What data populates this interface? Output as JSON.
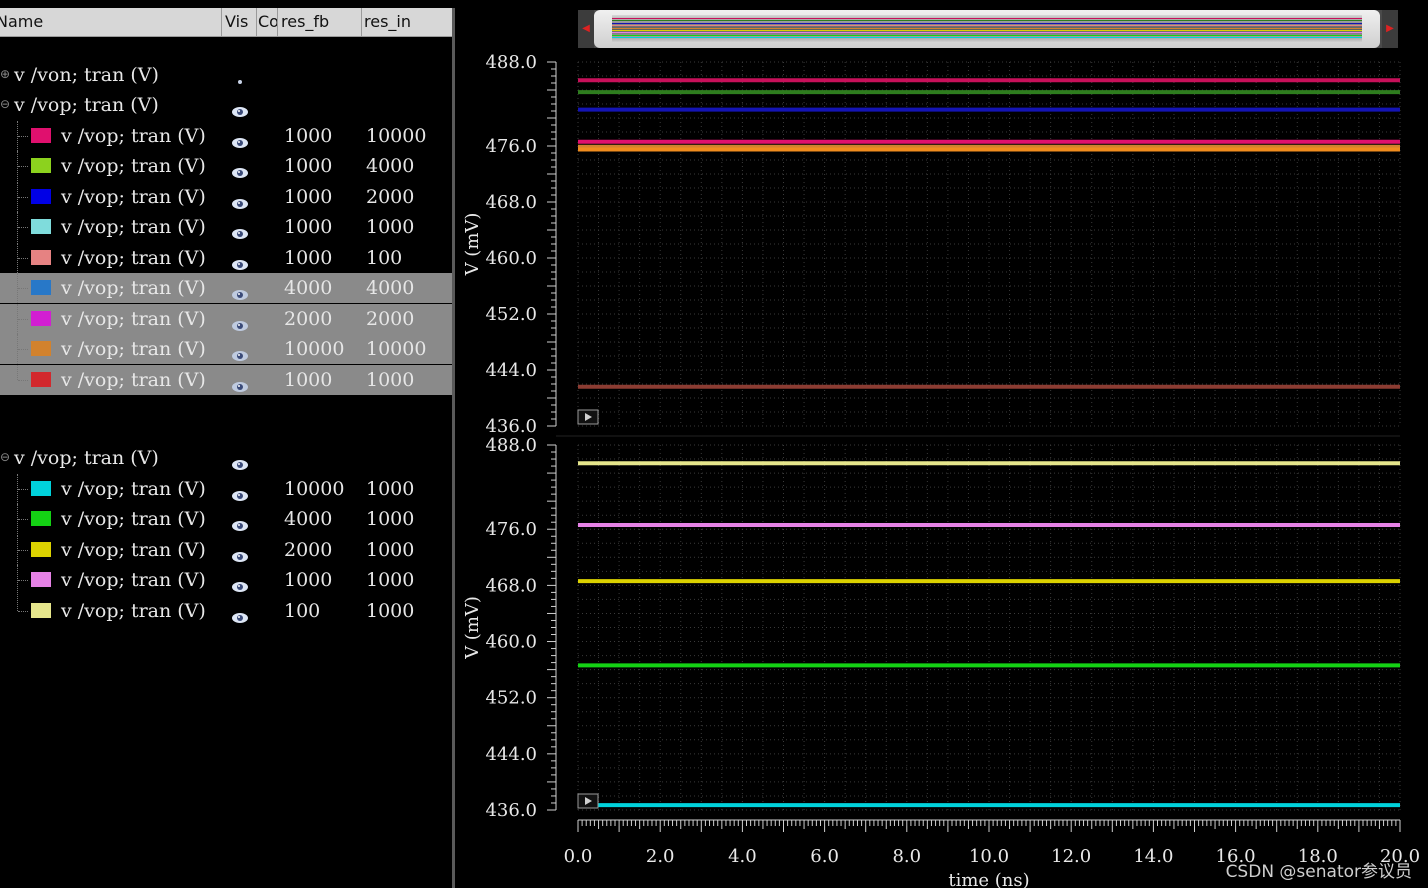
{
  "table": {
    "headers": {
      "name": "Name",
      "vis": "Vis",
      "co": "Co",
      "res_fb": "res_fb",
      "res_in": "res_in"
    }
  },
  "groups": [
    {
      "label": "v /von; tran (V)",
      "expander": "⊕",
      "visible": "dot"
    },
    {
      "label": "v /vop; tran (V)",
      "expander": "⊖",
      "visible": "eye",
      "signals": [
        {
          "label": "v /vop; tran (V)",
          "color": "#e0106e",
          "res_fb": "1000",
          "res_in": "10000",
          "selected": false
        },
        {
          "label": "v /vop; tran (V)",
          "color": "#8cd21e",
          "res_fb": "1000",
          "res_in": "4000",
          "selected": false
        },
        {
          "label": "v /vop; tran (V)",
          "color": "#0000e6",
          "res_fb": "1000",
          "res_in": "2000",
          "selected": false
        },
        {
          "label": "v /vop; tran (V)",
          "color": "#7fdcdc",
          "res_fb": "1000",
          "res_in": "1000",
          "selected": false
        },
        {
          "label": "v /vop; tran (V)",
          "color": "#e68282",
          "res_fb": "1000",
          "res_in": "100",
          "selected": false
        },
        {
          "label": "v /vop; tran (V)",
          "color": "#2878c8",
          "res_fb": "4000",
          "res_in": "4000",
          "selected": true
        },
        {
          "label": "v /vop; tran (V)",
          "color": "#d21ed2",
          "res_fb": "2000",
          "res_in": "2000",
          "selected": true
        },
        {
          "label": "v /vop; tran (V)",
          "color": "#d2822d",
          "res_fb": "10000",
          "res_in": "10000",
          "selected": true
        },
        {
          "label": "v /vop; tran (V)",
          "color": "#d2282d",
          "res_fb": "1000",
          "res_in": "1000",
          "selected": true
        }
      ]
    },
    {
      "label": "v /vop; tran (V)",
      "expander": "⊖",
      "visible": "eye",
      "signals": [
        {
          "label": "v /vop; tran (V)",
          "color": "#00d2dc",
          "res_fb": "10000",
          "res_in": "1000",
          "selected": false
        },
        {
          "label": "v /vop; tran (V)",
          "color": "#14d214",
          "res_fb": "4000",
          "res_in": "1000",
          "selected": false
        },
        {
          "label": "v /vop; tran (V)",
          "color": "#dcd200",
          "res_fb": "2000",
          "res_in": "1000",
          "selected": false
        },
        {
          "label": "v /vop; tran (V)",
          "color": "#e682e6",
          "res_fb": "1000",
          "res_in": "1000",
          "selected": false
        },
        {
          "label": "v /vop; tran (V)",
          "color": "#e6e68c",
          "res_fb": "100",
          "res_in": "1000",
          "selected": false
        }
      ]
    }
  ],
  "chart_data": [
    {
      "type": "line",
      "ylabel": "V (mV)",
      "xlabel": "",
      "ylim": [
        436.0,
        488.0
      ],
      "yticks": [
        "488.0",
        "476.0",
        "468.0",
        "460.0",
        "452.0",
        "444.0",
        "436.0"
      ],
      "xlim": [
        0,
        20
      ],
      "series": [
        {
          "color": "#c8105a",
          "y": 485.4
        },
        {
          "color": "#2e7d1e",
          "y": 483.7
        },
        {
          "color": "#1414b4",
          "y": 481.2
        },
        {
          "color": "#e0106e",
          "y": 476.6
        },
        {
          "color": "#d2822d",
          "y": 475.9
        },
        {
          "color": "#f08c1e",
          "y": 475.5
        },
        {
          "color": "#8c3c32",
          "y": 441.6
        }
      ]
    },
    {
      "type": "line",
      "ylabel": "V (mV)",
      "xlabel": "time (ns)",
      "ylim": [
        436.0,
        488.0
      ],
      "yticks": [
        "488.0",
        "476.0",
        "468.0",
        "460.0",
        "452.0",
        "444.0",
        "436.0"
      ],
      "xticks": [
        "0.0",
        "2.0",
        "4.0",
        "6.0",
        "8.0",
        "10.0",
        "12.0",
        "14.0",
        "16.0",
        "18.0",
        "20.0"
      ],
      "xlim": [
        0,
        20
      ],
      "series": [
        {
          "color": "#e6e68c",
          "y": 485.4
        },
        {
          "color": "#e682e6",
          "y": 476.6
        },
        {
          "color": "#dcd200",
          "y": 468.6
        },
        {
          "color": "#14d214",
          "y": 456.6
        },
        {
          "color": "#00d2dc",
          "y": 436.7
        }
      ]
    }
  ],
  "watermark": "CSDN @senator参议员"
}
